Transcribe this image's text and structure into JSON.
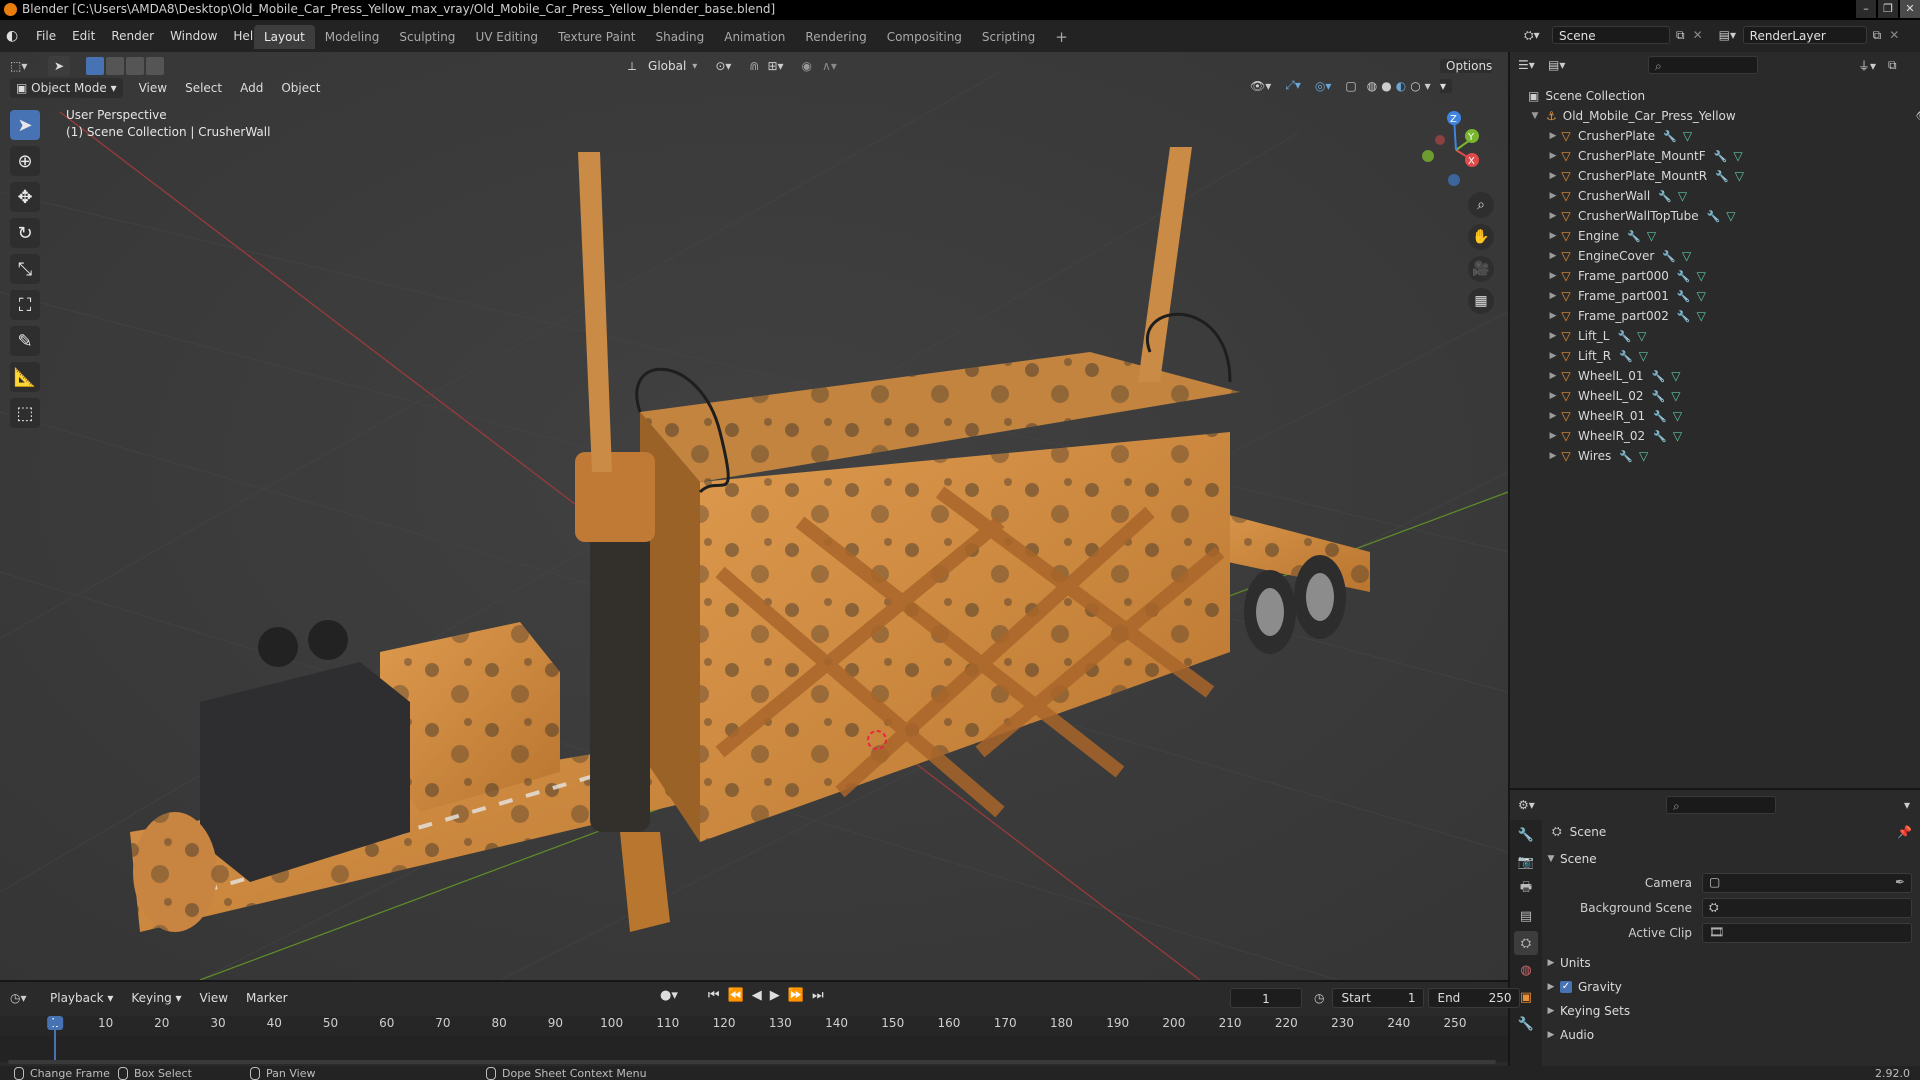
{
  "window": {
    "title": "Blender [C:\\Users\\AMDA8\\Desktop\\Old_Mobile_Car_Press_Yellow_max_vray/Old_Mobile_Car_Press_Yellow_blender_base.blend]"
  },
  "menu": [
    "File",
    "Edit",
    "Render",
    "Window",
    "Help"
  ],
  "workspaces": [
    "Layout",
    "Modeling",
    "Sculpting",
    "UV Editing",
    "Texture Paint",
    "Shading",
    "Animation",
    "Rendering",
    "Compositing",
    "Scripting"
  ],
  "workspace_add": "+",
  "scene_selector": {
    "value": "Scene"
  },
  "view_layer": {
    "value": "RenderLayer"
  },
  "viewport": {
    "mode": "Object Mode",
    "menus": [
      "View",
      "Select",
      "Add",
      "Object"
    ],
    "transform_orientation": "Global",
    "options": "Options",
    "overlay_text": {
      "perspective": "User Perspective",
      "collection": "(1) Scene Collection | CrusherWall"
    },
    "gizmo": {
      "x": "X",
      "y": "Y",
      "z": "Z"
    }
  },
  "outliner": {
    "root": "Scene Collection",
    "collection": "Old_Mobile_Car_Press_Yellow",
    "objects": [
      "CrusherPlate",
      "CrusherPlate_MountF",
      "CrusherPlate_MountR",
      "CrusherWall",
      "CrusherWallTopTube",
      "Engine",
      "EngineCover",
      "Frame_part000",
      "Frame_part001",
      "Frame_part002",
      "Lift_L",
      "Lift_R",
      "WheelL_01",
      "WheelL_02",
      "WheelR_01",
      "WheelR_02",
      "Wires"
    ]
  },
  "properties": {
    "context": "Scene",
    "panel": "Scene",
    "fields": [
      {
        "label": "Camera"
      },
      {
        "label": "Background Scene"
      },
      {
        "label": "Active Clip"
      }
    ],
    "collapsed_panels": [
      "Units",
      "Gravity",
      "Keying Sets",
      "Audio"
    ],
    "gravity_checked": true
  },
  "timeline": {
    "menus": [
      "Playback",
      "Keying",
      "View",
      "Marker"
    ],
    "current_frame": "1",
    "start_label": "Start",
    "start": "1",
    "end_label": "End",
    "end": "250",
    "ruler": [
      "1",
      "10",
      "20",
      "30",
      "40",
      "50",
      "60",
      "70",
      "80",
      "90",
      "100",
      "110",
      "120",
      "130",
      "140",
      "150",
      "160",
      "170",
      "180",
      "190",
      "200",
      "210",
      "220",
      "230",
      "240",
      "250"
    ]
  },
  "statusbar": {
    "items": [
      "Change Frame",
      "Box Select",
      "Pan View",
      "Dope Sheet Context Menu"
    ],
    "version": "2.92.0"
  },
  "colors": {
    "accent": "#4772b3",
    "object_orange": "#e8903a",
    "press_yellow": "#d88d3f",
    "x_axis": "#e04a4a",
    "y_axis": "#7ab530",
    "z_axis": "#3f84e0"
  }
}
